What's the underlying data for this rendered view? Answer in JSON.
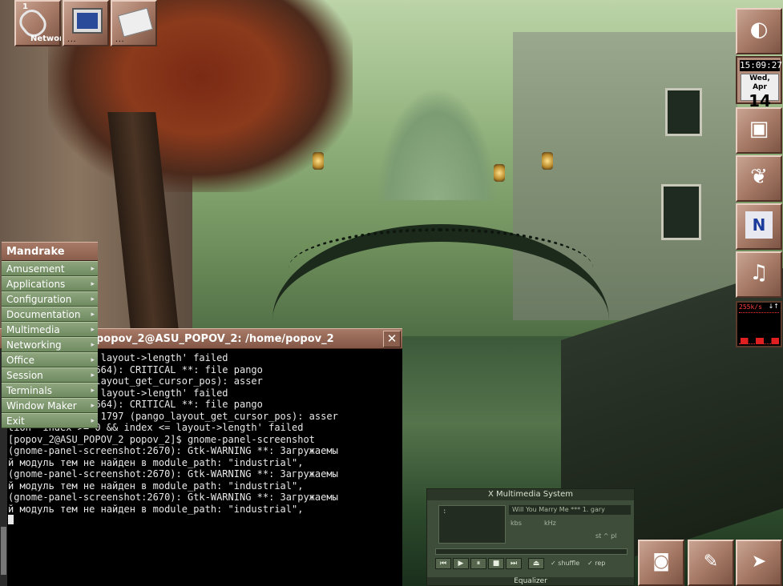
{
  "workspace": {
    "number": "1",
    "name": "Networ",
    "dots": "..."
  },
  "dock_top": [
    {
      "icon": "monitor-icon",
      "dots": "..."
    },
    {
      "icon": "editor-icon",
      "dots": "..."
    }
  ],
  "clock": {
    "time": "15:09:27",
    "day": "Wed, Apr",
    "date": "14"
  },
  "cpu_monitor": {
    "label": "255k/s",
    "arrows": "↓↑"
  },
  "menu": {
    "title": "Mandrake",
    "items": [
      {
        "label": "Amusement"
      },
      {
        "label": "Applications"
      },
      {
        "label": "Configuration"
      },
      {
        "label": "Documentation"
      },
      {
        "label": "Multimedia"
      },
      {
        "label": "Networking"
      },
      {
        "label": "Office"
      },
      {
        "label": "Session"
      },
      {
        "label": "Terminals"
      },
      {
        "label": "Window Maker"
      },
      {
        "label": "Exit"
      }
    ],
    "arrow": "▸"
  },
  "terminal": {
    "title": "popov_2@ASU_POPOV_2: /home/popov_2",
    "close": "✕",
    "lines": [
      "= 0 && index <= layout->length' failed",
      "",
      "el-screenshot:2664): CRITICAL **: file pango",
      "ne 1797 (pango_layout_get_cursor_pos): asser",
      "= 0 && index <= layout->length' failed",
      "",
      "el-screenshot:2664): CRITICAL **: file pango",
      "-layout.c: line 1797 (pango_layout_get_cursor_pos): asser",
      "tion `index >= 0 && index <= layout->length' failed",
      "[popov_2@ASU_POPOV_2 popov_2]$ gnome-panel-screenshot",
      "",
      "(gnome-panel-screenshot:2670): Gtk-WARNING **: Загружаемы",
      "й модуль тем не найден в module_path: \"industrial\",",
      "",
      "(gnome-panel-screenshot:2670): Gtk-WARNING **: Загружаемы",
      "й модуль тем не найден в module_path: \"industrial\",",
      "",
      "(gnome-panel-screenshot:2670): Gtk-WARNING **: Загружаемы",
      "й модуль тем не найден в module_path: \"industrial\","
    ]
  },
  "xmms": {
    "title": "X Multimedia System",
    "time": ":",
    "song": "Will You Marry Me ***  1. gary",
    "kbps": "kbs",
    "khz": "kHz",
    "stereo": "st ^ pl",
    "buttons": [
      "⏮",
      "▶",
      "⏸",
      "■",
      "⏭",
      "⏏"
    ],
    "shuffle": "✓ shuffle",
    "repeat": "✓ rep",
    "equalizer": "Equalizer"
  }
}
